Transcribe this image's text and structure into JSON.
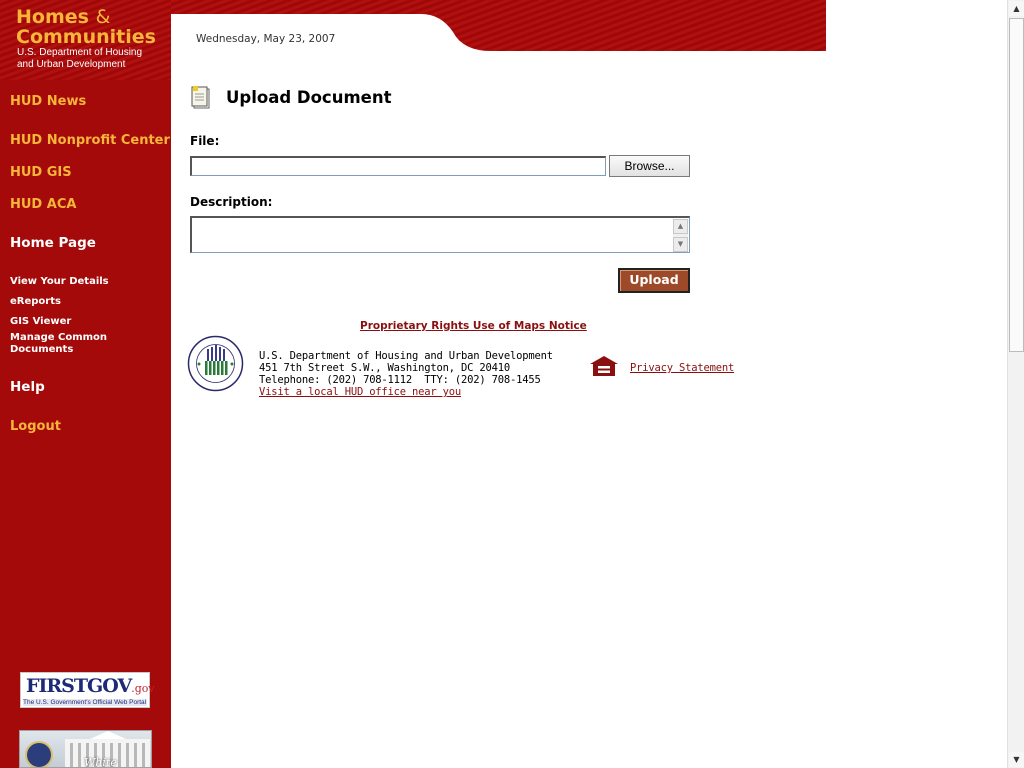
{
  "logo": {
    "line1": "Homes",
    "amp": "&",
    "line2": "Communities",
    "sub1": "U.S. Department of Housing",
    "sub2": "and Urban Development"
  },
  "header": {
    "date": "Wednesday, May 23, 2007"
  },
  "sidebar": {
    "items": [
      {
        "label": "HUD News"
      },
      {
        "label": "HUD Nonprofit Center"
      },
      {
        "label": "HUD GIS"
      },
      {
        "label": "HUD ACA"
      },
      {
        "label": "Home Page"
      },
      {
        "label": "View Your Details"
      },
      {
        "label": "eReports"
      },
      {
        "label": "GIS Viewer"
      },
      {
        "label": "Manage Common"
      },
      {
        "label": "Documents"
      },
      {
        "label": "Help"
      },
      {
        "label": "Logout"
      }
    ],
    "firstgov": {
      "main": "FIRSTGOV",
      "gov": ".gov",
      "tag": "The U.S. Government's Official Web Portal"
    },
    "whitehouse": {
      "text": "White House"
    }
  },
  "main": {
    "title": "Upload Document",
    "file_label": "File:",
    "file_value": "",
    "browse_label": "Browse...",
    "description_label": "Description:",
    "description_value": "",
    "upload_label": "Upload"
  },
  "footer": {
    "maps_link": "Proprietary Rights Use of Maps Notice",
    "address_line1": "U.S. Department of Housing and Urban Development",
    "address_line2": "451 7th Street S.W., Washington, DC 20410",
    "address_line3": "Telephone: (202) 708-1112  TTY: (202) 708-1455",
    "local_office_link": "Visit a local HUD office near you",
    "privacy_link": "Privacy Statement"
  },
  "colors": {
    "sidebar_bg": "#a50a0a",
    "nav_gold": "#f7b53a",
    "link_red": "#8a1010",
    "upload_btn": "#9c4a2a"
  },
  "icons": {
    "page": "document-icon",
    "eho": "equal-housing-icon",
    "seal": "hud-seal-icon"
  }
}
